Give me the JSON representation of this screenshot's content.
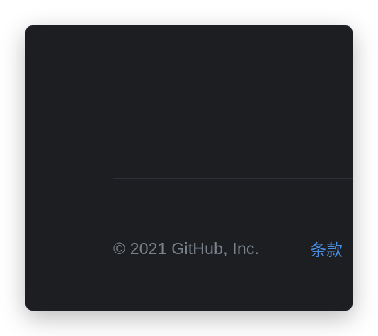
{
  "footer": {
    "copyright": "© 2021 GitHub, Inc.",
    "links": [
      {
        "label": "条款"
      }
    ]
  },
  "colors": {
    "background": "#1c1e22",
    "divider": "#2d3036",
    "muted_text": "#7a828c",
    "link": "#4a8fe6"
  }
}
